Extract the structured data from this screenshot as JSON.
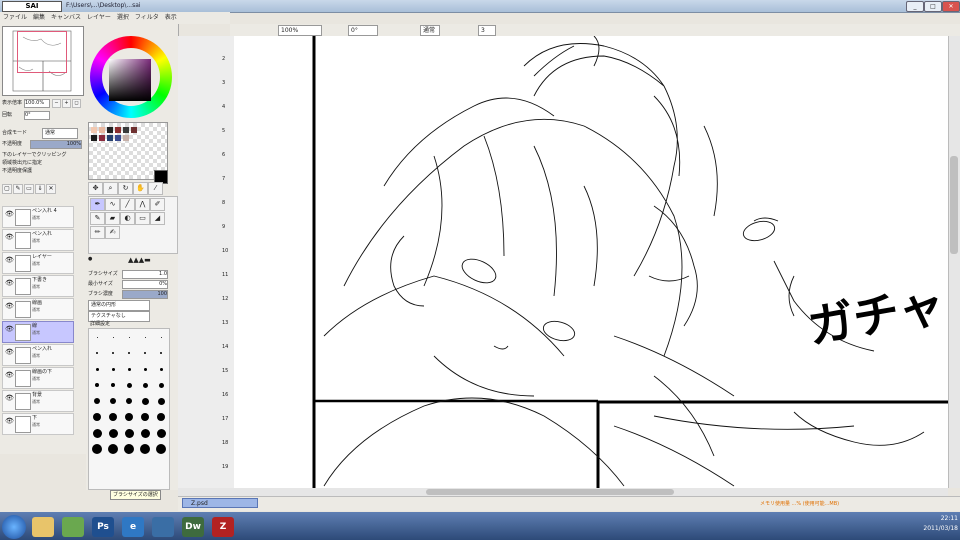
{
  "window": {
    "app_logo": "SAI",
    "title": "F:\\Users\\...\\Desktop\\...sai",
    "buttons": {
      "minimize": "_",
      "maximize": "□",
      "close": "✕"
    }
  },
  "menubar": {
    "items": [
      "ファイル",
      "編集",
      "キャンバス",
      "レイヤー",
      "選択",
      "フィルタ",
      "表示",
      "ウィンドウ",
      "その他"
    ]
  },
  "toolbar": {
    "zoom_value": "100%",
    "angle_value": "0°",
    "stabilizer_value": "3",
    "normal_label": "通常"
  },
  "navigator": {
    "zoom_label": "表示倍率",
    "zoom_value": "100.0%",
    "angle_label": "回転",
    "angle_value": "0°"
  },
  "layer_panel": {
    "mode_label": "合成モード",
    "mode_value": "通常",
    "opacity_label": "不透明度",
    "opacity_value": "100%",
    "check1": "下のレイヤーでクリッピング",
    "check2": "領域検出元に指定",
    "check3": "不透明度保護",
    "layers": [
      {
        "name": "ペン入れ 4",
        "mode": "通常",
        "selected": false
      },
      {
        "name": "ペン入れ",
        "mode": "通常",
        "selected": false
      },
      {
        "name": "レイヤー",
        "mode": "通常",
        "selected": false
      },
      {
        "name": "下書き",
        "mode": "通常",
        "selected": false
      },
      {
        "name": "線画",
        "mode": "通常",
        "selected": false
      },
      {
        "name": "線",
        "mode": "通常",
        "selected": true
      },
      {
        "name": "ペン入れ",
        "mode": "通常",
        "selected": false
      },
      {
        "name": "線画の下",
        "mode": "通常",
        "selected": false
      },
      {
        "name": "背景",
        "mode": "通常",
        "selected": false
      },
      {
        "name": "下",
        "mode": "通常",
        "selected": false
      }
    ]
  },
  "tool_panel": {
    "brush_size_label": "ブラシサイズ",
    "brush_size_value": "1.0",
    "min_size_label": "最小サイズ",
    "min_size_value": "0%",
    "density_label": "ブラシ濃度",
    "density_value": "100",
    "texture1": "通常の円形",
    "texture2": "テクスチャなし",
    "detail_label": "詳細設定",
    "tooltip": "ブラシサイズの選択"
  },
  "swatches": [
    "#f2c8b0",
    "#e8b8a0",
    "#222222",
    "#8b2d2d",
    "#3a3a3a",
    "#6e3030",
    "#1a1a1a",
    "#8a2b3d",
    "#25406e",
    "#3a4a8e",
    "#c6b0a8"
  ],
  "current_color": "#000000",
  "canvas": {
    "ruler_marks": [
      "2",
      "3",
      "4",
      "5",
      "6",
      "7",
      "8",
      "9",
      "10",
      "11",
      "12",
      "13",
      "14",
      "15",
      "16",
      "17",
      "18",
      "19"
    ],
    "sfx_text": "ガチャ"
  },
  "statusbar": {
    "doc_tab": "Z.psd",
    "memory_text": "メモリ使用量 ...% (使用可能...MB)"
  },
  "taskbar": {
    "apps": [
      {
        "icon": "folder-icon",
        "label": ""
      },
      {
        "icon": "photo-icon",
        "label": ""
      },
      {
        "icon": "photoshop-icon",
        "label": "Ps"
      },
      {
        "icon": "ie-icon",
        "label": "e"
      },
      {
        "icon": "network-icon",
        "label": ""
      },
      {
        "icon": "dreamweaver-icon",
        "label": "Dw"
      },
      {
        "icon": "filezilla-icon",
        "label": "Z"
      }
    ],
    "time": "22:11",
    "date": "2011/03/18"
  }
}
